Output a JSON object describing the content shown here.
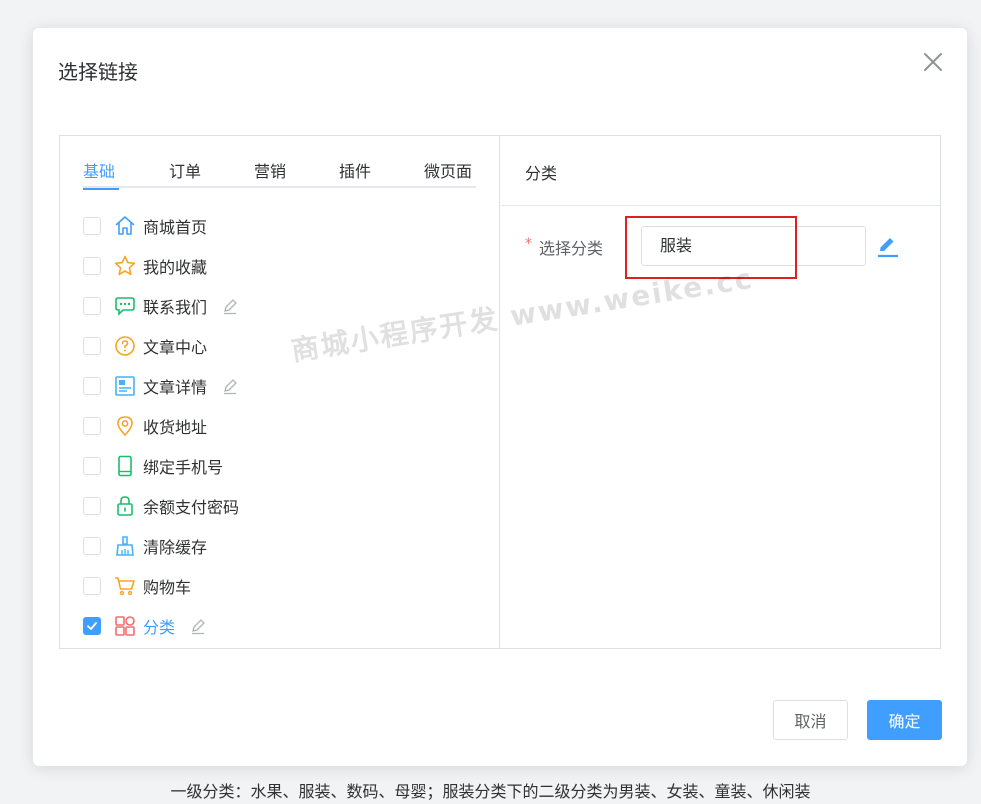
{
  "dialog": {
    "title": "选择链接",
    "close_icon": "close-icon"
  },
  "tabs": [
    {
      "label": "基础",
      "active": true
    },
    {
      "label": "订单",
      "active": false
    },
    {
      "label": "营销",
      "active": false
    },
    {
      "label": "插件",
      "active": false
    },
    {
      "label": "微页面",
      "active": false
    }
  ],
  "link_items": [
    {
      "label": "商城首页",
      "icon": "home-icon",
      "checked": false,
      "editable": false
    },
    {
      "label": "我的收藏",
      "icon": "star-icon",
      "checked": false,
      "editable": false
    },
    {
      "label": "联系我们",
      "icon": "chat-icon",
      "checked": false,
      "editable": true
    },
    {
      "label": "文章中心",
      "icon": "question-icon",
      "checked": false,
      "editable": false
    },
    {
      "label": "文章详情",
      "icon": "article-icon",
      "checked": false,
      "editable": true
    },
    {
      "label": "收货地址",
      "icon": "location-icon",
      "checked": false,
      "editable": false
    },
    {
      "label": "绑定手机号",
      "icon": "phone-icon",
      "checked": false,
      "editable": false
    },
    {
      "label": "余额支付密码",
      "icon": "lock-icon",
      "checked": false,
      "editable": false
    },
    {
      "label": "清除缓存",
      "icon": "broom-icon",
      "checked": false,
      "editable": false
    },
    {
      "label": "购物车",
      "icon": "cart-icon",
      "checked": false,
      "editable": false
    },
    {
      "label": "分类",
      "icon": "category-icon",
      "checked": true,
      "editable": true
    }
  ],
  "right_panel": {
    "title": "分类",
    "required_mark": "*",
    "field_label": "选择分类",
    "field_value": "服装"
  },
  "watermark": "商城小程序开发 www.weike.cc",
  "footer": {
    "cancel_label": "取消",
    "ok_label": "确定"
  },
  "caption": "一级分类：水果、服装、数码、母婴；服装分类下的二级分类为男装、女装、童装、休闲装",
  "colors": {
    "primary": "#409eff",
    "highlight_border": "#e02020",
    "required": "#f56c6c"
  }
}
